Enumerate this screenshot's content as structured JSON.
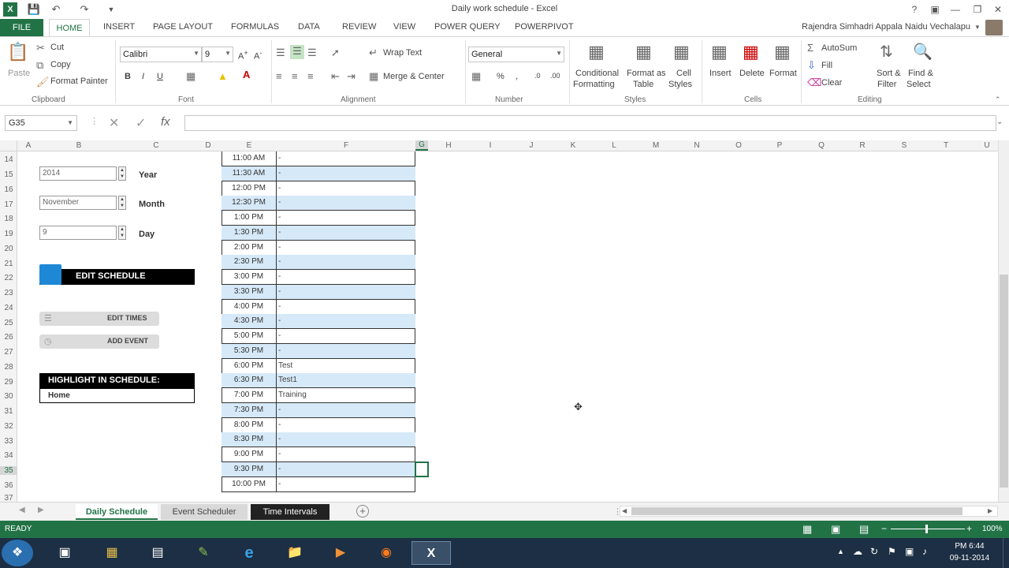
{
  "window": {
    "title": "Daily work schedule - Excel",
    "help": "?",
    "user": "Rajendra Simhadri Appala Naidu Vechalapu"
  },
  "tabs": [
    "FILE",
    "HOME",
    "INSERT",
    "PAGE LAYOUT",
    "FORMULAS",
    "DATA",
    "REVIEW",
    "VIEW",
    "POWER QUERY",
    "POWERPIVOT"
  ],
  "ribbon": {
    "clipboard": {
      "paste": "Paste",
      "cut": "Cut",
      "copy": "Copy",
      "format_painter": "Format Painter",
      "label": "Clipboard"
    },
    "font": {
      "name": "Calibri",
      "size": "9",
      "label": "Font",
      "bold": "B",
      "italic": "I",
      "underline": "U"
    },
    "alignment": {
      "wrap": "Wrap Text",
      "merge": "Merge & Center",
      "label": "Alignment"
    },
    "number": {
      "format": "General",
      "label": "Number"
    },
    "styles": {
      "conditional": "Conditional",
      "conditional2": "Formatting",
      "format_as": "Format as",
      "format_as2": "Table",
      "cell": "Cell",
      "cell2": "Styles",
      "label": "Styles"
    },
    "cells": {
      "insert": "Insert",
      "delete": "Delete",
      "format": "Format",
      "label": "Cells"
    },
    "editing": {
      "autosum": "AutoSum",
      "fill": "Fill",
      "clear": "Clear",
      "sort": "Sort &",
      "sort2": "Filter",
      "find": "Find &",
      "find2": "Select",
      "label": "Editing"
    }
  },
  "formula_bar": {
    "name_box": "G35",
    "formula": ""
  },
  "columns": [
    "A",
    "B",
    "C",
    "D",
    "E",
    "F",
    "G",
    "H",
    "I",
    "J",
    "K",
    "L",
    "M",
    "N",
    "O",
    "P",
    "Q",
    "R",
    "S",
    "T",
    "U"
  ],
  "rows": [
    "14",
    "15",
    "16",
    "17",
    "18",
    "19",
    "20",
    "21",
    "22",
    "23",
    "24",
    "25",
    "26",
    "27",
    "28",
    "29",
    "30",
    "31",
    "32",
    "33",
    "34",
    "35",
    "36",
    "37"
  ],
  "controls": {
    "year_value": "2014",
    "year_label": "Year",
    "month_value": "November",
    "month_label": "Month",
    "day_value": "9",
    "day_label": "Day",
    "edit_schedule": "EDIT SCHEDULE",
    "edit_times": "EDIT TIMES",
    "add_event": "ADD EVENT",
    "highlight_title": "HIGHLIGHT IN SCHEDULE:",
    "highlight_value": "Home"
  },
  "schedule": [
    {
      "time": "11:00 AM",
      "event": "-"
    },
    {
      "time": "11:30 AM",
      "event": "-"
    },
    {
      "time": "12:00 PM",
      "event": "-"
    },
    {
      "time": "12:30 PM",
      "event": "-"
    },
    {
      "time": "1:00 PM",
      "event": "-"
    },
    {
      "time": "1:30 PM",
      "event": "-"
    },
    {
      "time": "2:00 PM",
      "event": "-"
    },
    {
      "time": "2:30 PM",
      "event": "-"
    },
    {
      "time": "3:00 PM",
      "event": "-"
    },
    {
      "time": "3:30 PM",
      "event": "-"
    },
    {
      "time": "4:00 PM",
      "event": "-"
    },
    {
      "time": "4:30 PM",
      "event": "-"
    },
    {
      "time": "5:00 PM",
      "event": "-"
    },
    {
      "time": "5:30 PM",
      "event": "-"
    },
    {
      "time": "6:00 PM",
      "event": "Test"
    },
    {
      "time": "6:30 PM",
      "event": "Test1"
    },
    {
      "time": "7:00 PM",
      "event": "Training"
    },
    {
      "time": "7:30 PM",
      "event": "-"
    },
    {
      "time": "8:00 PM",
      "event": "-"
    },
    {
      "time": "8:30 PM",
      "event": "-"
    },
    {
      "time": "9:00 PM",
      "event": "-"
    },
    {
      "time": "9:30 PM",
      "event": "-"
    },
    {
      "time": "10:00 PM",
      "event": "-"
    }
  ],
  "sheets": [
    "Daily Schedule",
    "Event Scheduler",
    "Time Intervals"
  ],
  "status": {
    "ready": "READY",
    "zoom": "100%"
  },
  "clock": {
    "time": "PM 6:44",
    "date": "09-11-2014"
  },
  "colors": {
    "excel_green": "#217346",
    "row_blue": "#d6e9f8",
    "taskbar": "#1d2f44"
  }
}
